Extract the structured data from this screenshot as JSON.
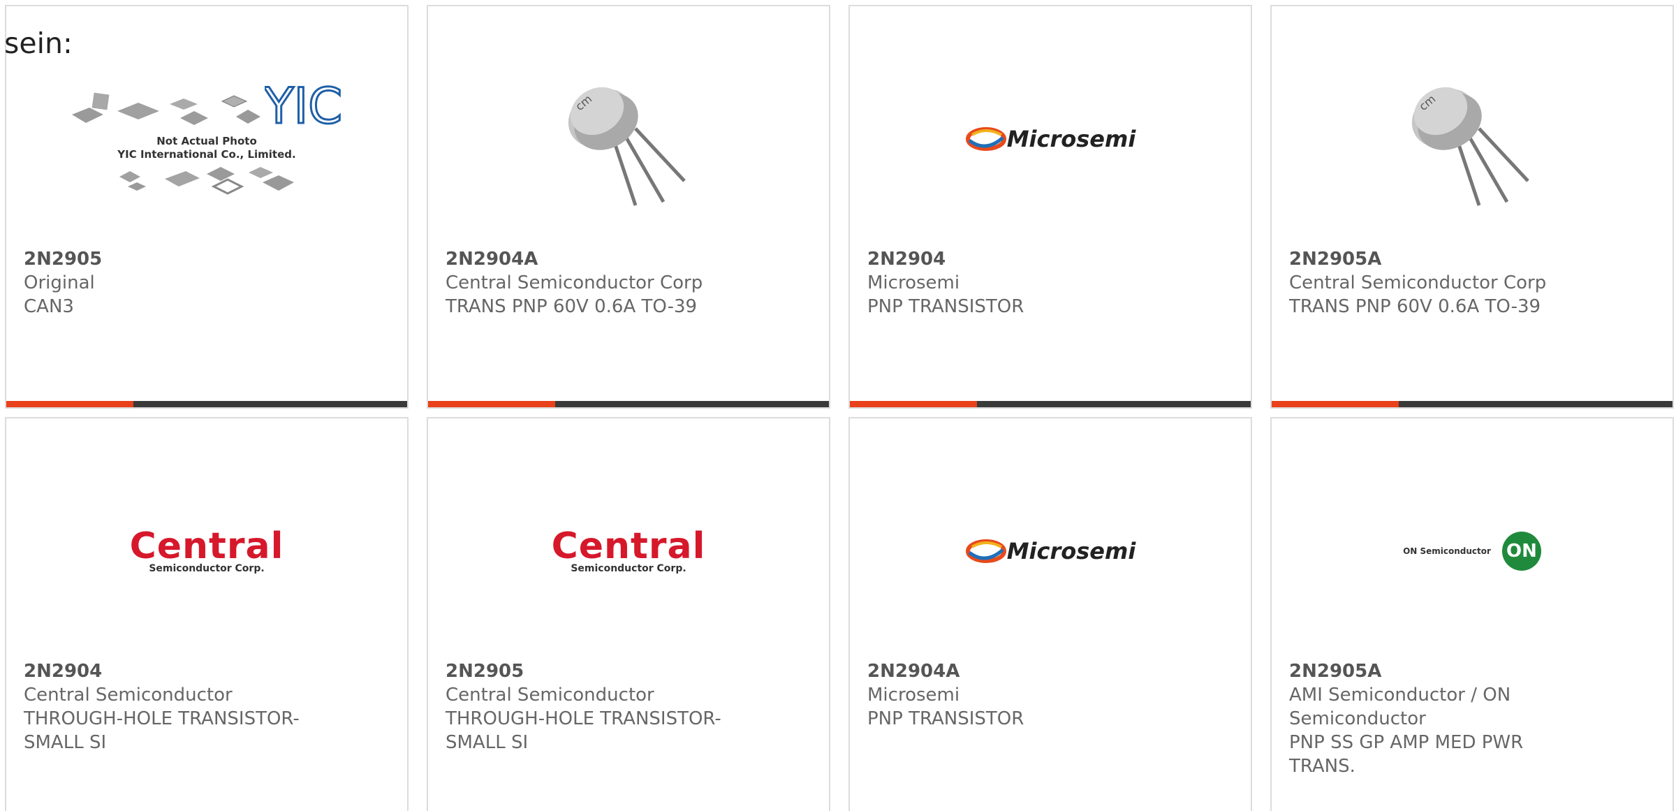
{
  "lead_text": "sein:",
  "colors": {
    "accent": "#e8411b",
    "bar": "#3a3a3a",
    "border": "#dcdcdc",
    "text": "#666666"
  },
  "logos": {
    "yic_line1": "Not Actual Photo",
    "yic_line2": "YIC International Co., Limited.",
    "yic_mark": "YIC",
    "central_word": "Central",
    "central_sub": "Semiconductor Corp.",
    "microsemi": "Microsemi",
    "on_text": "ON Semiconductor",
    "on_mark": "ON"
  },
  "products": [
    {
      "part": "2N2905",
      "maker": "Original",
      "desc": "CAN3",
      "image": "yic-placeholder"
    },
    {
      "part": "2N2904A",
      "maker": "Central Semiconductor Corp",
      "desc": "TRANS PNP 60V 0.6A TO-39",
      "image": "to39-transistor"
    },
    {
      "part": "2N2904",
      "maker": "Microsemi",
      "desc": "PNP TRANSISTOR",
      "image": "microsemi-logo"
    },
    {
      "part": "2N2905A",
      "maker": "Central Semiconductor Corp",
      "desc": "TRANS PNP 60V 0.6A TO-39",
      "image": "to39-transistor"
    },
    {
      "part": "2N2904",
      "maker": "Central Semiconductor",
      "desc": "THROUGH-HOLE TRANSISTOR-SMALL SI",
      "image": "central-logo"
    },
    {
      "part": "2N2905",
      "maker": "Central Semiconductor",
      "desc": "THROUGH-HOLE TRANSISTOR-SMALL SI",
      "image": "central-logo"
    },
    {
      "part": "2N2904A",
      "maker": "Microsemi",
      "desc": "PNP TRANSISTOR",
      "image": "microsemi-logo"
    },
    {
      "part": "2N2905A",
      "maker": "AMI Semiconductor / ON Semiconductor",
      "desc": "PNP SS GP AMP MED PWR TRANS.",
      "image": "on-semi-logo"
    }
  ]
}
